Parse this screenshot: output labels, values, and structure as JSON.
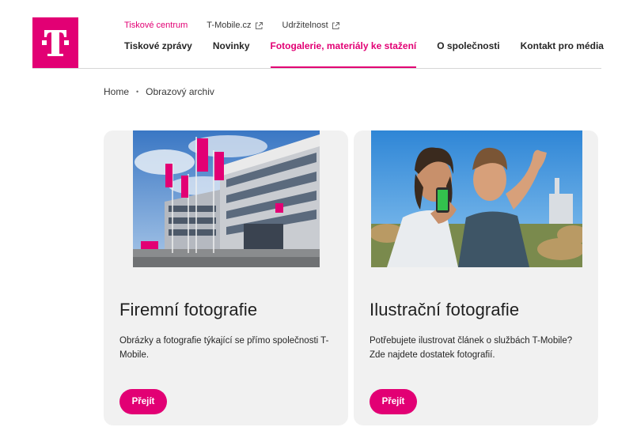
{
  "brand": {
    "logo": "telekom-t-logo",
    "accent_color": "#e20074"
  },
  "top_nav": [
    {
      "label": "Tiskové centrum",
      "external": false,
      "active": true
    },
    {
      "label": "T-Mobile.cz",
      "external": true,
      "icon": "external-link-icon"
    },
    {
      "label": "Udržitelnost",
      "external": true,
      "icon": "external-link-icon"
    }
  ],
  "main_nav": [
    {
      "label": "Tiskové zprávy"
    },
    {
      "label": "Novinky"
    },
    {
      "label": "Fotogalerie, materiály ke stažení",
      "active": true
    },
    {
      "label": "O společnosti"
    },
    {
      "label": "Kontakt pro média"
    }
  ],
  "breadcrumb": {
    "items": [
      "Home",
      "Obrazový archiv"
    ],
    "separator": "•"
  },
  "cards": [
    {
      "image": "office-building-with-magenta-flags",
      "title": "Firemní fotografie",
      "text": "Obrázky a fotografie týkající se přímo společnosti T-Mobile.",
      "button": "Přejít"
    },
    {
      "image": "two-young-men-looking-at-phone",
      "title": "Ilustrační fotografie",
      "text": "Potřebujete ilustrovat článek o službách T-Mobile? Zde najdete dostatek fotografií.",
      "button": "Přejít"
    }
  ]
}
